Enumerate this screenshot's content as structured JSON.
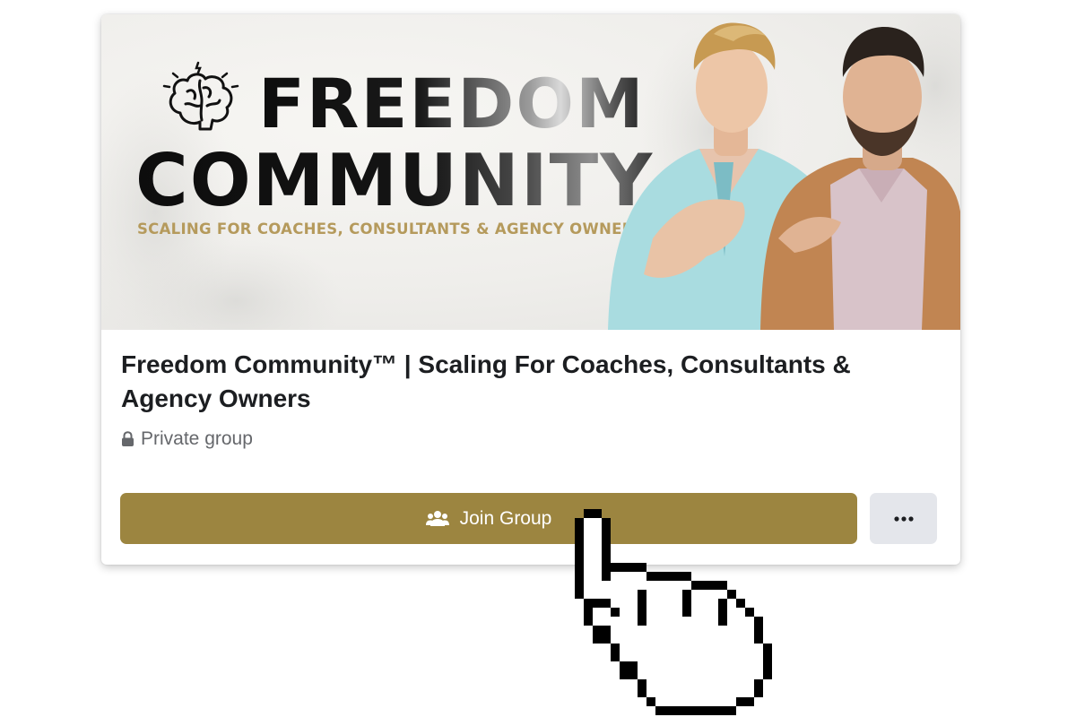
{
  "banner": {
    "title_line1": "FREEDOM",
    "title_line2": "COMMUNITY",
    "tagline": "SCALING FOR COACHES, CONSULTANTS & AGENCY OWNERS",
    "logo_icon": "brain-icon"
  },
  "group": {
    "name": "Freedom Community™ | Scaling For Coaches, Consultants & Agency Owners",
    "privacy": "Private group",
    "privacy_icon": "lock-icon"
  },
  "actions": {
    "join_label": "Join Group",
    "join_icon": "people-icon",
    "more_icon": "more-options-icon"
  },
  "colors": {
    "join_button": "#9c8540",
    "tagline": "#b59a5c",
    "more_button": "#e4e6eb"
  },
  "cursor_icon": "pointing-hand-cursor-icon"
}
